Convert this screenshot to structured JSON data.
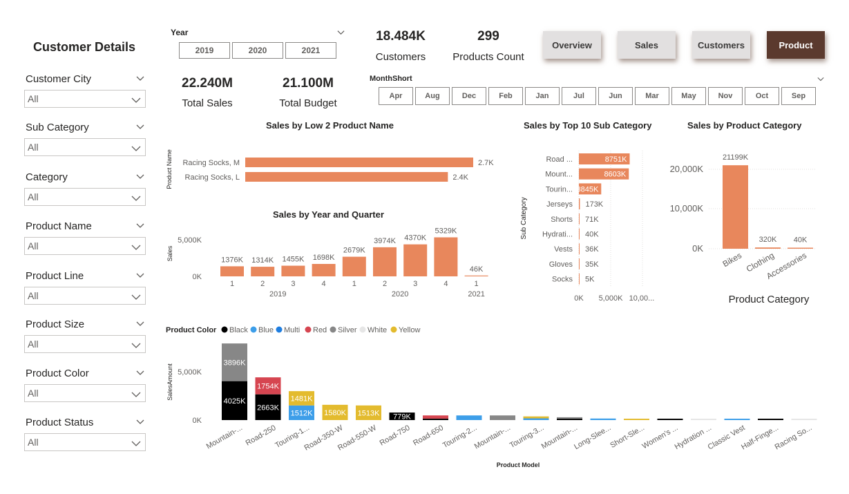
{
  "sidebar": {
    "title": "Customer Details",
    "slicers": [
      {
        "label": "Customer City",
        "value": "All"
      },
      {
        "label": "Sub Category",
        "value": "All"
      },
      {
        "label": "Category",
        "value": "All"
      },
      {
        "label": "Product Name",
        "value": "All"
      },
      {
        "label": "Product Line",
        "value": "All"
      },
      {
        "label": "Product Size",
        "value": "All"
      },
      {
        "label": "Product Color",
        "value": "All"
      },
      {
        "label": "Product Status",
        "value": "All"
      }
    ]
  },
  "year_slicer": {
    "title": "Year",
    "options": [
      "2019",
      "2020",
      "2021"
    ]
  },
  "kpis": {
    "customers": {
      "value": "18.484K",
      "label": "Customers"
    },
    "products": {
      "value": "299",
      "label": "Products Count"
    },
    "sales": {
      "value": "22.240M",
      "label": "Total Sales"
    },
    "budget": {
      "value": "21.100M",
      "label": "Total Budget"
    }
  },
  "nav": {
    "overview": "Overview",
    "sales": "Sales",
    "customers": "Customers",
    "product": "Product",
    "active": "Product"
  },
  "month_slicer": {
    "title": "MonthShort",
    "options": [
      "Apr",
      "Aug",
      "Dec",
      "Feb",
      "Jan",
      "Jul",
      "Jun",
      "Mar",
      "May",
      "Nov",
      "Oct",
      "Sep"
    ]
  },
  "colors": {
    "bar": "#e8875c",
    "black": "#000000",
    "blue": "#3d9ee9",
    "multi": "#1f7ee0",
    "red": "#d64550",
    "silver": "#878787",
    "white": "#e6e6e6",
    "yellow": "#e3bb2e"
  },
  "chart_data": [
    {
      "id": "low2",
      "type": "bar",
      "orientation": "horizontal",
      "title": "Sales by Low 2 Product Name",
      "ylabel": "Product Name",
      "categories": [
        "Racing Socks, M",
        "Racing Socks, L"
      ],
      "values": [
        2.7,
        2.4
      ],
      "value_labels": [
        "2.7K",
        "2.4K"
      ],
      "unit": "K",
      "xlim": [
        0,
        3
      ]
    },
    {
      "id": "yq",
      "type": "bar",
      "title": "Sales  by Year and Quarter",
      "ylabel": "Sales",
      "ytick_labels": [
        "0K",
        "5,000K"
      ],
      "ylim": [
        0,
        5500
      ],
      "categories": [
        "1",
        "2",
        "3",
        "4",
        "1",
        "2",
        "3",
        "4",
        "1"
      ],
      "years": [
        {
          "label": "2019",
          "count": 4
        },
        {
          "label": "2020",
          "count": 4
        },
        {
          "label": "2021",
          "count": 1
        }
      ],
      "values": [
        1376,
        1314,
        1455,
        1698,
        2679,
        3974,
        4370,
        5329,
        46
      ],
      "value_labels": [
        "1376K",
        "1314K",
        "1455K",
        "1698K",
        "2679K",
        "3974K",
        "4370K",
        "5329K",
        "46K"
      ]
    },
    {
      "id": "top10",
      "type": "bar",
      "orientation": "horizontal",
      "title": "Sales by Top 10 Sub Category",
      "ylabel": "Sub Category",
      "categories": [
        "Road ...",
        "Mount...",
        "Tourin...",
        "Jerseys",
        "Shorts",
        "Hydrati...",
        "Vests",
        "Gloves",
        "Socks"
      ],
      "values": [
        8751,
        8603,
        3845,
        173,
        71,
        40,
        36,
        35,
        5
      ],
      "value_labels": [
        "8751K",
        "8603K",
        "3845K",
        "173K",
        "71K",
        "40K",
        "36K",
        "35K",
        "5K"
      ],
      "xtick_labels": [
        "0K",
        "5,000K",
        "10,00..."
      ],
      "xlim": [
        0,
        12000
      ]
    },
    {
      "id": "category",
      "type": "bar",
      "title": "Sales by Product Category",
      "xlabel": "Product Category",
      "categories": [
        "Bikes",
        "Clothing",
        "Accessories"
      ],
      "values": [
        21199,
        320,
        40
      ],
      "value_labels": [
        "21199K",
        "320K",
        "40K"
      ],
      "ytick_labels": [
        "0K",
        "10,000K",
        "20,000K"
      ],
      "ylim": [
        0,
        23000
      ]
    },
    {
      "id": "color",
      "type": "bar",
      "stacked": true,
      "title": "Product Color",
      "xlabel": "Product Model",
      "ylabel": "SalesAmount",
      "ytick_labels": [
        "0K",
        "5,000K"
      ],
      "ylim": [
        0,
        8400
      ],
      "legend": [
        "Black",
        "Blue",
        "Multi",
        "Red",
        "Silver",
        "White",
        "Yellow"
      ],
      "categories": [
        "Mountain-...",
        "Road-250",
        "Touring-1...",
        "Road-350-W",
        "Road-550-W",
        "Road-750",
        "Road-650",
        "Touring-2...",
        "Mountain-...",
        "Touring-3...",
        "Mountain-...",
        "Long-Slee...",
        "Short-Sle...",
        "Women's ...",
        "Hydration ...",
        "Classic Vest",
        "Half-Finge...",
        "Racing So..."
      ],
      "series": [
        {
          "name": "Black",
          "values": [
            4025,
            2663,
            0,
            0,
            0,
            779,
            150,
            0,
            0,
            0,
            150,
            0,
            0,
            70,
            0,
            0,
            60,
            0
          ],
          "labels": [
            "4025K",
            "2663K",
            "",
            "",
            "",
            "779K",
            "",
            "",
            "",
            "",
            "",
            "",
            "",
            "",
            "",
            "",
            "",
            ""
          ]
        },
        {
          "name": "Blue",
          "values": [
            0,
            0,
            1512,
            0,
            0,
            0,
            0,
            480,
            0,
            180,
            0,
            160,
            0,
            0,
            0,
            50,
            0,
            0
          ],
          "labels": [
            "",
            "",
            "1512K",
            "",
            "",
            "",
            "",
            "",
            "",
            "",
            "",
            "",
            "",
            "",
            "",
            "",
            "",
            ""
          ]
        },
        {
          "name": "Multi",
          "values": [
            0,
            0,
            0,
            0,
            0,
            0,
            0,
            0,
            0,
            0,
            0,
            0,
            0,
            0,
            0,
            0,
            0,
            0
          ],
          "labels": [
            "",
            "",
            "",
            "",
            "",
            "",
            "",
            "",
            "",
            "",
            "",
            "",
            "",
            "",
            "",
            "",
            "",
            ""
          ]
        },
        {
          "name": "Red",
          "values": [
            0,
            1754,
            0,
            0,
            0,
            0,
            330,
            0,
            0,
            0,
            0,
            0,
            0,
            0,
            0,
            0,
            0,
            0
          ],
          "labels": [
            "",
            "1754K",
            "",
            "",
            "",
            "",
            "",
            "",
            "",
            "",
            "",
            "",
            "",
            "",
            "",
            "",
            "",
            ""
          ]
        },
        {
          "name": "Silver",
          "values": [
            3896,
            0,
            0,
            0,
            0,
            0,
            0,
            0,
            480,
            0,
            120,
            0,
            0,
            0,
            0,
            0,
            0,
            0
          ],
          "labels": [
            "3896K",
            "",
            "",
            "",
            "",
            "",
            "",
            "",
            "",
            "",
            "",
            "",
            "",
            "",
            "",
            "",
            "",
            ""
          ]
        },
        {
          "name": "White",
          "values": [
            0,
            0,
            0,
            0,
            0,
            0,
            0,
            0,
            0,
            0,
            0,
            0,
            0,
            0,
            40,
            0,
            0,
            30
          ],
          "labels": [
            "",
            "",
            "",
            "",
            "",
            "",
            "",
            "",
            "",
            "",
            "",
            "",
            "",
            "",
            "",
            "",
            "",
            ""
          ]
        },
        {
          "name": "Yellow",
          "values": [
            0,
            0,
            1481,
            1580,
            1513,
            0,
            0,
            0,
            0,
            200,
            0,
            0,
            120,
            0,
            0,
            0,
            0,
            0
          ],
          "labels": [
            "",
            "",
            "1481K",
            "1580K",
            "1513K",
            "",
            "",
            "",
            "",
            "",
            "",
            "",
            "",
            "",
            "",
            "",
            "",
            ""
          ]
        }
      ]
    }
  ]
}
